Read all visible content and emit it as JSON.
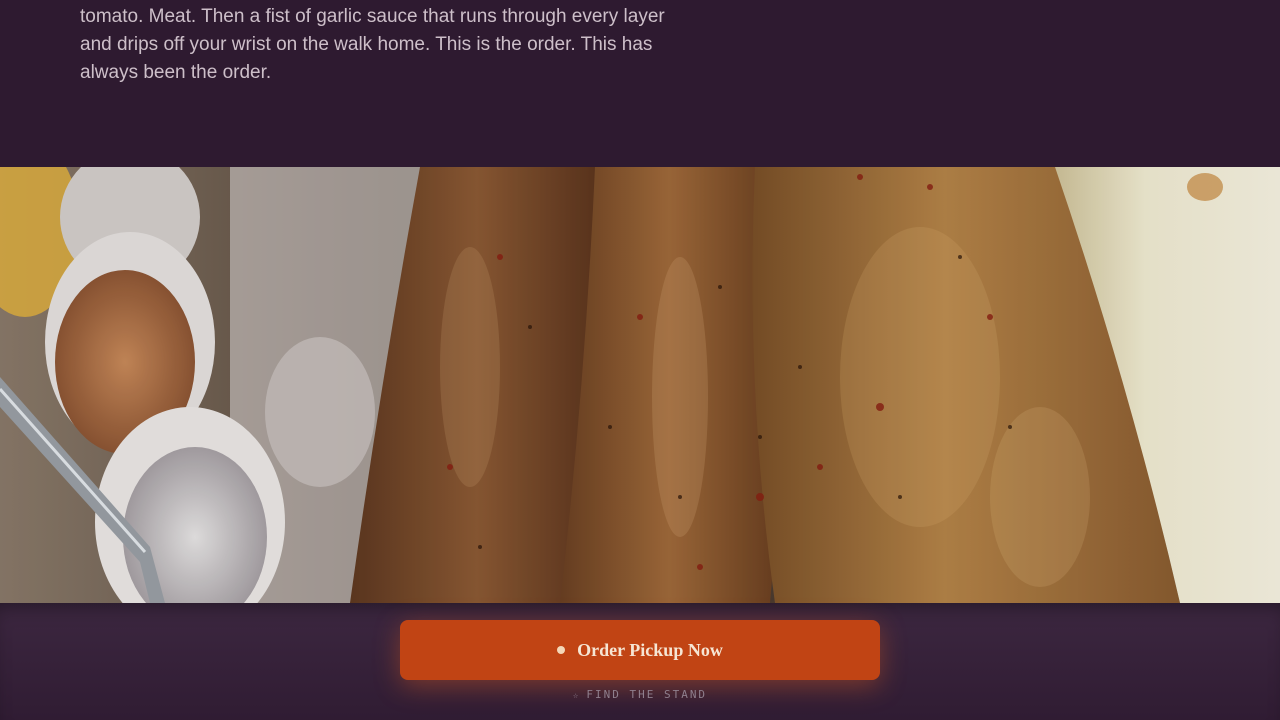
{
  "intro": {
    "text": "tomato. Meat. Then a fist of garlic sauce that runs through every layer and drips off your wrist on the walk home. This is the order. This has always been the order."
  },
  "hero": {
    "alt": "Grilled kebab skewers with dipping sauces and flatbread"
  },
  "cta": {
    "order_label": "Order Pickup Now",
    "find_label": "FIND THE STAND",
    "find_icon": "☆"
  },
  "colors": {
    "background": "#2e1a30",
    "accent": "#c14414",
    "text": "#cdbfc9"
  }
}
